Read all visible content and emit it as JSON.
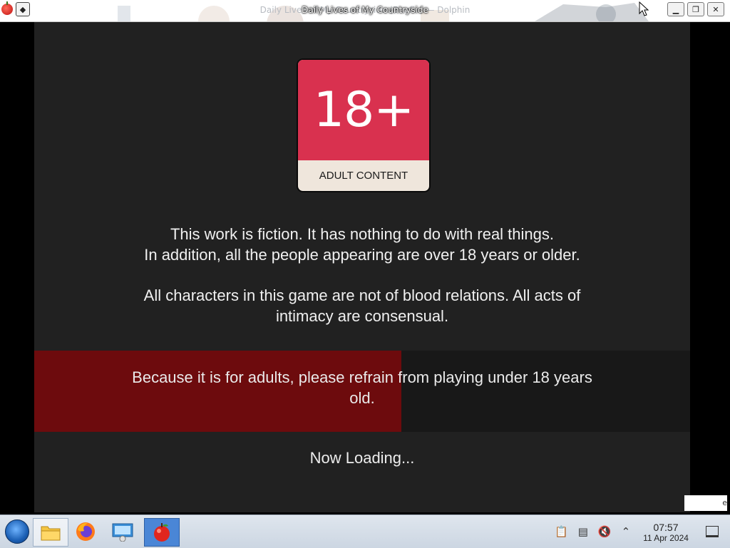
{
  "window": {
    "title": "Daily Lives of My Countryside",
    "ghost_title": "Daily Lives of My Countryside (Bugfix) — Dolphin"
  },
  "game": {
    "badge_number": "18+",
    "badge_label": "ADULT CONTENT",
    "disclaimer_line1": "This work is fiction. It has nothing to do with real things.",
    "disclaimer_line2": "In addition, all the people appearing are over 18 years or older.",
    "disclaimer_2": "All characters in this game are not of blood relations. All acts of intimacy are consensual.",
    "warning": "Because it is for adults, please refrain from playing under 18 years old.",
    "loading": "Now Loading...",
    "progress": 0.56
  },
  "edge_fragment": "e",
  "taskbar": {
    "time": "07:57",
    "date": "11 Apr 2024"
  },
  "colors": {
    "badge_red": "#d9314f",
    "badge_cream": "#efe6dc",
    "progress_red": "#6d0b0d",
    "game_bg": "#212121"
  }
}
